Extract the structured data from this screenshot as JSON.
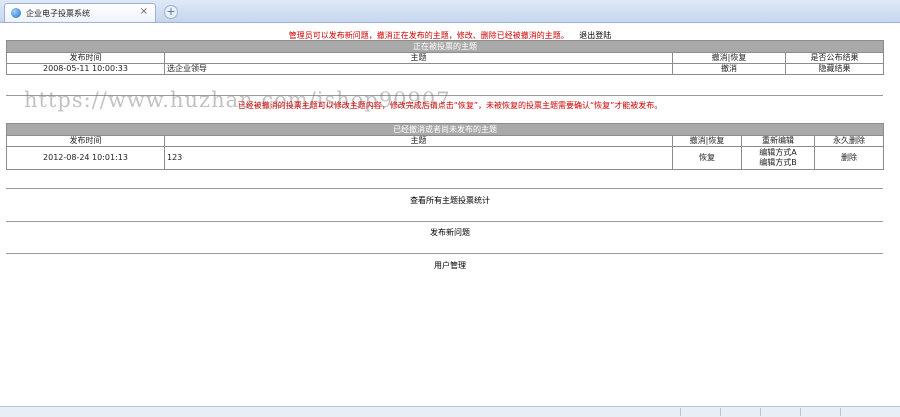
{
  "browser": {
    "tab_title": "企业电子投票系统",
    "close_glyph": "×",
    "new_tab_glyph": "+"
  },
  "notice": {
    "text": "管理员可以发布新问题，撤消正在发布的主题，修改、删除已经被撤消的主题。",
    "logout": "退出登陆"
  },
  "active_topics": {
    "caption": "正在被投票的主题",
    "headers": [
      "发布时间",
      "主题",
      "撤消|恢复",
      "是否公布结果"
    ],
    "rows": [
      {
        "time": "2008-05-11 10:00:33",
        "topic": "选企业领导",
        "action": "撤消",
        "result": "隐藏结果"
      }
    ]
  },
  "info_line": "已经被撤消的投票主题可以修改主题内容，修改完成后请点击“恢复”，未被恢复的投票主题需要确认“恢复”才能被发布。",
  "watermark": "https://www.huzhan.com/ishop90907",
  "cancelled_topics": {
    "caption": "已经撤消或者尚未发布的主题",
    "headers": [
      "发布时间",
      "主题",
      "撤消|恢复",
      "重新编辑",
      "永久删除"
    ],
    "rows": [
      {
        "time": "2012-08-24 10:01:13",
        "topic": "123",
        "action": "恢复",
        "edit_a": "编辑方式A",
        "edit_b": "编辑方式B",
        "delete": "删除"
      }
    ]
  },
  "links": {
    "stats": "查看所有主题投票统计",
    "publish": "发布新问题",
    "users": "用户管理"
  }
}
